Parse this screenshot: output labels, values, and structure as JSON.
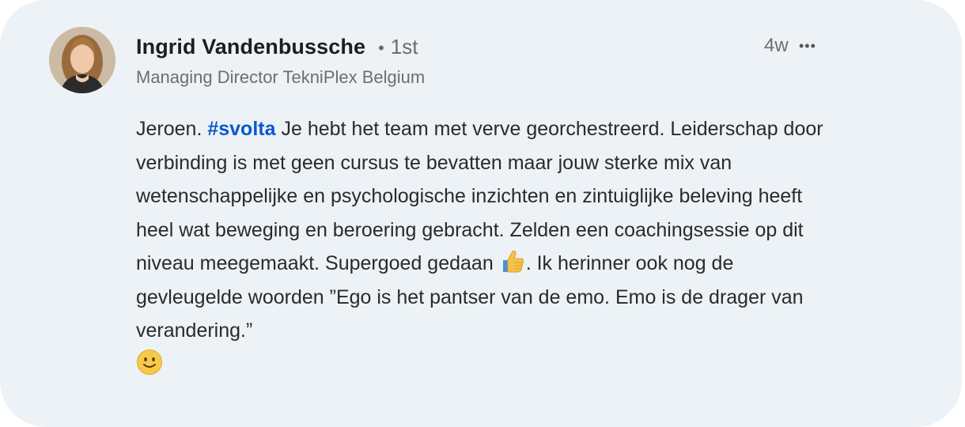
{
  "comment": {
    "author": {
      "name": "Ingrid Vandenbussche",
      "separator": "•",
      "connection": "1st",
      "headline": "Managing Director TekniPlex Belgium"
    },
    "time_ago": "4w",
    "more_label": "•••",
    "body": {
      "lead": "Jeroen.",
      "hashtag": "#svolta",
      "text_1": "Je hebt het team met verve georchestreerd. Leiderschap door verbinding is met geen cursus te bevatten maar jouw sterke mix van wetenschappelijke en psychologische inzichten en zintuiglijke beleving heeft heel wat beweging en beroering gebracht. Zelden een coachingsessie op dit niveau meegemaakt. Supergoed gedaan",
      "emoji_1": "thumbs-up-emoji",
      "text_2": ". Ik herinner ook nog de gevleugelde woorden ”Ego is het pantser van de emo. Emo is de drager van verandering.”",
      "emoji_2": "slightly-smiling-face-emoji"
    }
  },
  "colors": {
    "card_background": "#edf2f7",
    "hashtag": "#0a58ca",
    "name_text": "#1d1d1f",
    "secondary_text": "#6e6e6e"
  }
}
